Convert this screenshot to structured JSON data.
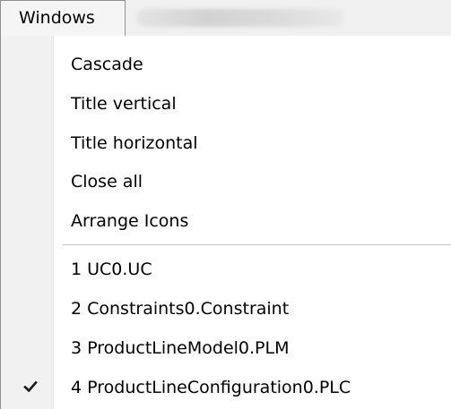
{
  "menubar": {
    "menu_title": "Windows"
  },
  "menu": {
    "items": [
      {
        "label": "Cascade"
      },
      {
        "label": "Title vertical"
      },
      {
        "label": "Title horizontal"
      },
      {
        "label": "Close all"
      },
      {
        "label": "Arrange Icons"
      }
    ],
    "windows": [
      {
        "label": "1 UC0.UC",
        "checked": false
      },
      {
        "label": "2 Constraints0.Constraint",
        "checked": false
      },
      {
        "label": "3 ProductLineModel0.PLM",
        "checked": false
      },
      {
        "label": "4 ProductLineConfiguration0.PLC",
        "checked": true
      }
    ]
  },
  "icons": {
    "check": "check-icon"
  },
  "colors": {
    "gutter": "#f1f1f1",
    "border": "#8e8f8f",
    "text": "#000000"
  }
}
